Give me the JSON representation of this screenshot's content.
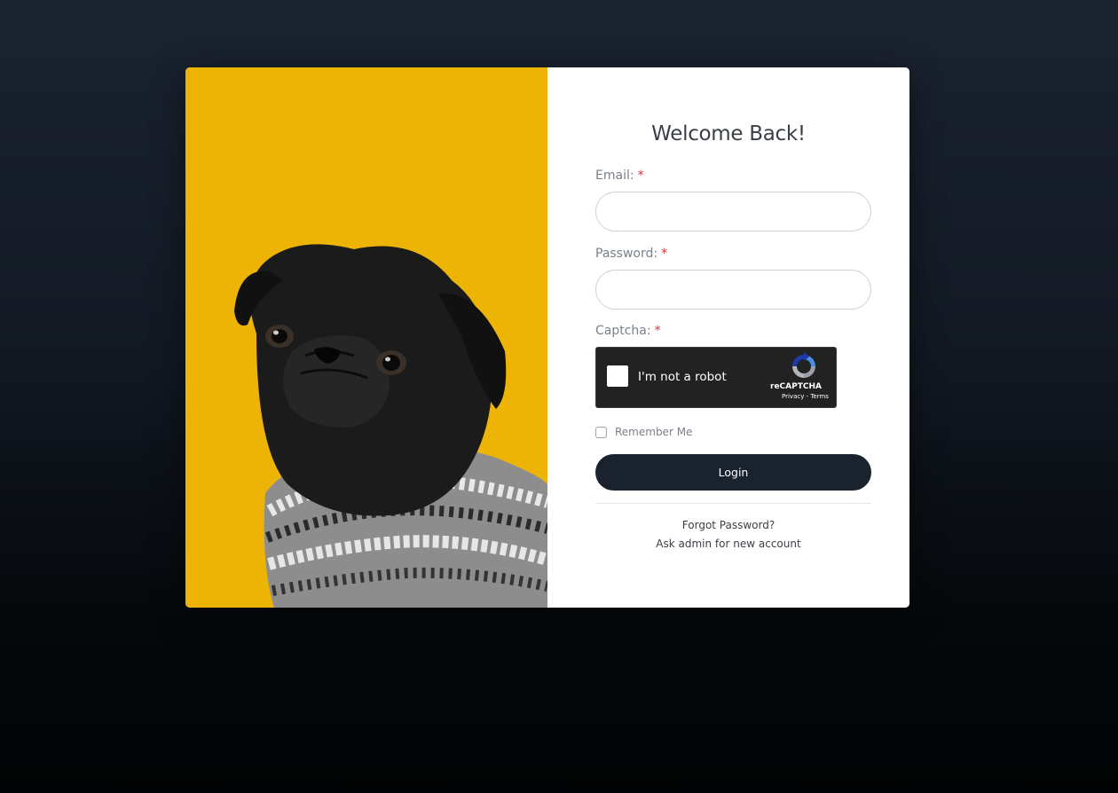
{
  "hero": {
    "image": "black pug wearing knitted sweater on yellow background",
    "background_color": "#edb405"
  },
  "form": {
    "title": "Welcome Back!",
    "email": {
      "label": "Email:",
      "required_mark": "*",
      "value": "",
      "placeholder": ""
    },
    "password": {
      "label": "Password:",
      "required_mark": "*",
      "value": "",
      "placeholder": ""
    },
    "captcha": {
      "label": "Captcha:",
      "required_mark": "*",
      "checkbox_text": "I'm not a robot",
      "brand": "reCAPTCHA",
      "links": "Privacy - Terms"
    },
    "remember_label": "Remember Me",
    "login_button": "Login",
    "forgot_password": "Forgot Password?",
    "ask_admin": "Ask admin for new account"
  },
  "colors": {
    "button": "#1a222d",
    "required": "#d9363e",
    "accent_yellow": "#edb405"
  }
}
